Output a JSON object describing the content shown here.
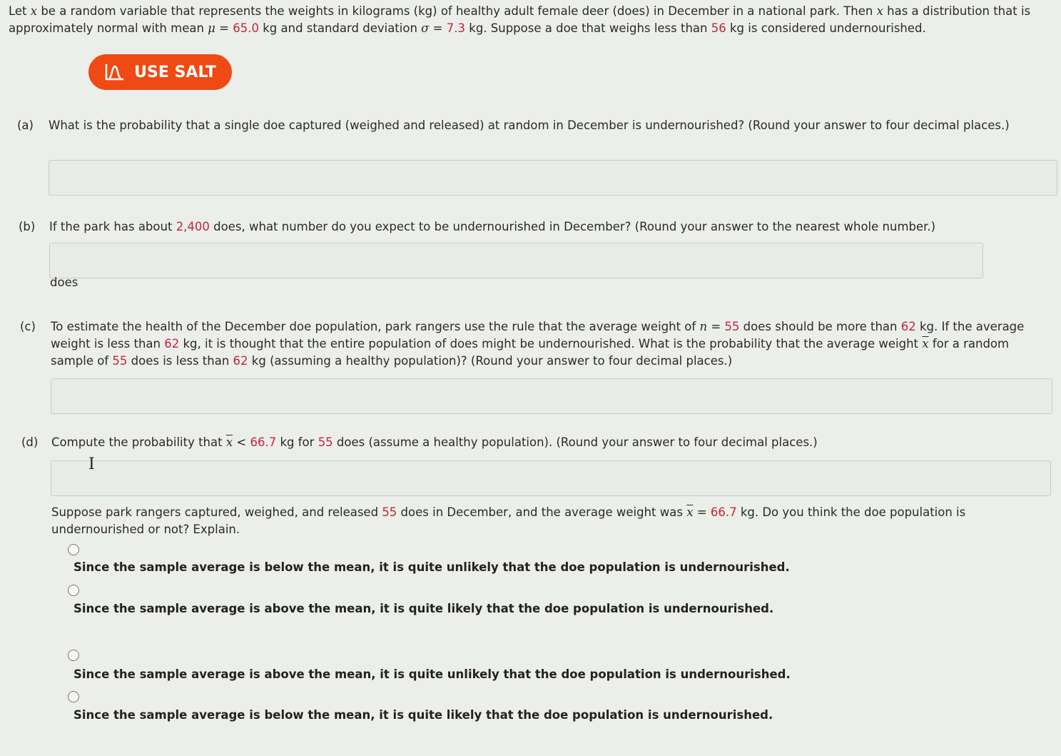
{
  "intro": {
    "p1": "Let ",
    "x": "x",
    "p2": " be a random variable that represents the weights in kilograms (kg) of healthy adult female deer (does) in December in a national park. Then ",
    "p3": " has a distribution that is approximately normal with mean ",
    "mu": "μ",
    "eq": " = ",
    "mean": "65.0",
    "p4": " kg and standard deviation ",
    "sigma": "σ",
    "sd": "7.3",
    "p5": " kg. Suppose a doe that weighs less than ",
    "threshold": "56",
    "p6": " kg is considered undernourished."
  },
  "salt_button": {
    "label": "USE SALT"
  },
  "part_a": {
    "label": "(a)",
    "text": "What is the probability that a single doe captured (weighed and released) at random in December is undernourished? (Round your answer to four decimal places.)",
    "answer": ""
  },
  "part_b": {
    "label": "(b)",
    "t1": "If the park has about ",
    "population": "2,400",
    "t2": " does, what number do you expect to be undernourished in December? (Round your answer to the nearest whole number.)",
    "answer": "",
    "unit": "does"
  },
  "part_c": {
    "label": "(c)",
    "t1": "To estimate the health of the December doe population, park rangers use the rule that the average weight of ",
    "n": "n",
    "t2": " = ",
    "n_val": "55",
    "t3": " does should be more than ",
    "w1": "62",
    "t4": " kg. If the average weight is less than ",
    "w2": "62",
    "t5": " kg, it is thought that the entire population of does might be undernourished. What is the probability that the average weight ",
    "xbar": "x",
    "t6": " for a random sample of ",
    "n2": "55",
    "t7": " does is less than ",
    "w3": "62",
    "t8": " kg (assuming a healthy population)? (Round your answer to four decimal places.)",
    "answer": ""
  },
  "part_d": {
    "label": "(d)",
    "t1": "Compute the probability that ",
    "xbar": "x",
    "t2": " < ",
    "val": "66.7",
    "t3": " kg for ",
    "n": "55",
    "t4": " does (assume a healthy population). (Round your answer to four decimal places.)",
    "answer": "",
    "cursor": "I"
  },
  "followup": {
    "t1": "Suppose park rangers captured, weighed, and released ",
    "n": "55",
    "t2": " does in December, and the average weight was ",
    "xbar": "x",
    "t3": " = ",
    "val": "66.7",
    "t4": " kg. Do you think the doe population is undernourished or not? Explain.",
    "options": [
      "Since the sample average is below the mean, it is quite unlikely that the doe population is undernourished.",
      "Since the sample average is above the mean, it is quite likely that the doe population is undernourished.",
      "Since the sample average is above the mean, it is quite unlikely that the doe population is undernourished.",
      "Since the sample average is below the mean, it is quite likely that the doe population is undernourished."
    ]
  }
}
